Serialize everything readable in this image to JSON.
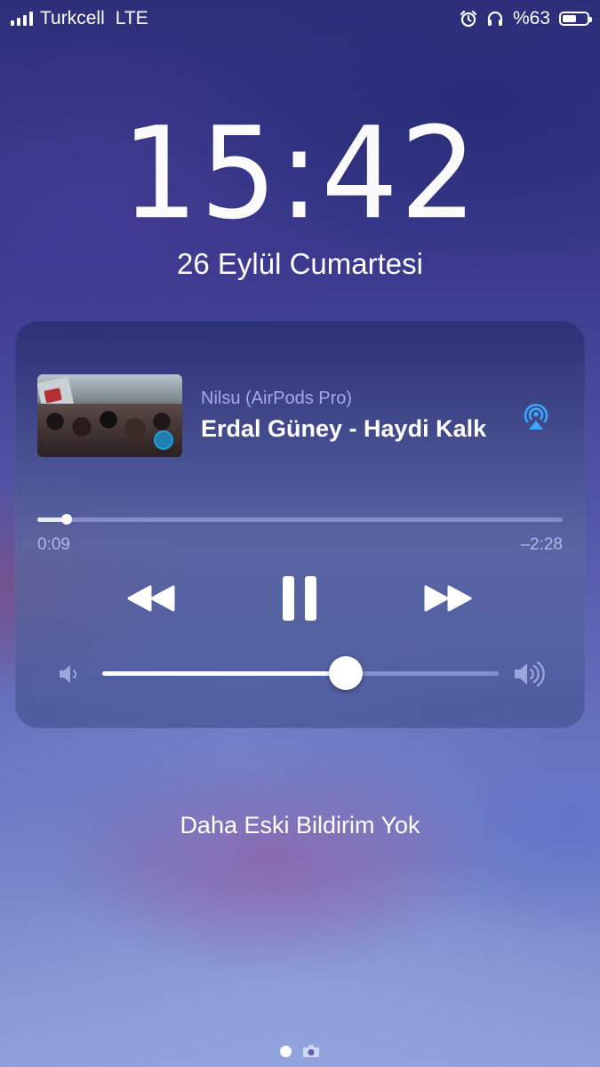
{
  "status_bar": {
    "carrier": "Turkcell",
    "network": "LTE",
    "battery_label": "%63",
    "battery_level": 0.63,
    "icons": [
      "signal-icon",
      "alarm-icon",
      "headphones-icon",
      "battery-icon"
    ]
  },
  "lock_screen": {
    "time": "15:42",
    "date": "26 Eylül Cumartesi",
    "notification_text": "Daha Eski Bildirim Yok"
  },
  "now_playing": {
    "device": "Nilsu (AirPods Pro)",
    "title": "Erdal Güney - Haydi Kalk",
    "elapsed": "0:09",
    "remaining": "–2:28",
    "progress": 0.055,
    "volume": 0.615,
    "controls": [
      "rewind-icon",
      "pause-icon",
      "fast-forward-icon"
    ],
    "accent_color": "#3aa8ff",
    "device_color": "#a9a6f0"
  },
  "page_indicator": {
    "active_index": 0,
    "items": [
      "page-dot",
      "camera-icon"
    ]
  }
}
